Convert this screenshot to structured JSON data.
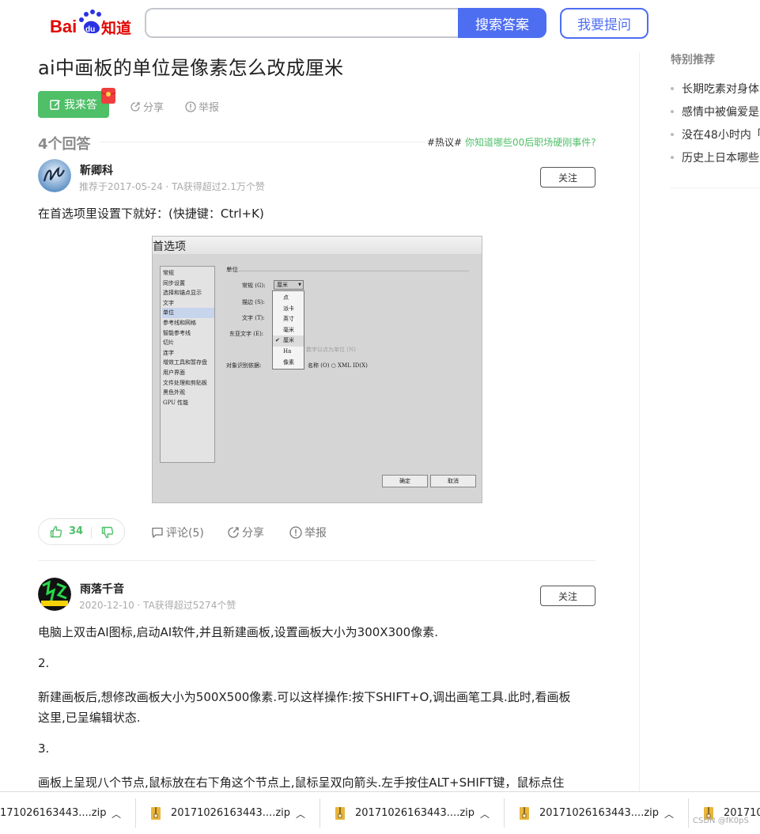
{
  "header": {
    "logo_text": "Bai du 知道",
    "search_placeholder": "",
    "search_button": "搜索答案",
    "ask_button": "我要提问"
  },
  "question": {
    "title": "ai中画板的单位是像素怎么改成厘米",
    "answer_button": "我来答",
    "share": "分享",
    "report": "举报"
  },
  "answers_header": {
    "count_label": "4个回答",
    "hot_tag": "#热议#",
    "hot_text": "你知道哪些00后职场硬刚事件?"
  },
  "answers": [
    {
      "author": "靳卿科",
      "meta": "推荐于2017-05-24 · TA获得超过2.1万个赞",
      "follow": "关注",
      "text": "在首选项里设置下就好：(快捷键：Ctrl+K)",
      "likes": "34",
      "comments": "评论(5)",
      "share": "分享",
      "report": "举报"
    },
    {
      "author": "雨落千音",
      "meta": "2020-12-10 · TA获得超过5274个赞",
      "follow": "关注",
      "paragraphs": [
        "电脑上双击AI图标,启动AI软件,并且新建画板,设置画板大小为300X300像素.",
        "2.",
        "新建画板后,想修改画板大小为500X500像素.可以这样操作:按下SHIFT+O,调出画笔工具.此时,看画板",
        "这里,已呈编辑状态.",
        "3.",
        "画板上呈现八个节点,鼠标放在右下角这个节点上,鼠标呈双向箭头.左手按住ALT+SHIFT键，鼠标点住"
      ]
    }
  ],
  "pref_dialog": {
    "title": "首选项",
    "list": [
      "常规",
      "同步设置",
      "选择和锚点显示",
      "文字",
      "单位",
      "参考线和网格",
      "智能参考线",
      "切片",
      "连字",
      "增效工具和暂存盘",
      "用户界面",
      "文件处理和剪贴板",
      "黑色外观",
      "GPU 性能"
    ],
    "section": "单位",
    "labels": [
      "常规 (G):",
      "描边 (S):",
      "文字 (T):",
      "东亚文字 (E):",
      "对象识别依据:"
    ],
    "combo_value": "厘米",
    "options": [
      "点",
      "派卡",
      "英寸",
      "毫米",
      "厘米",
      "Ha",
      "像素"
    ],
    "faint_text": "数字以点为单位 (N)",
    "radio_text": "名称 (O)  ○ XML ID(X)",
    "ok": "确定",
    "cancel": "取消"
  },
  "sidebar": {
    "title": "特别推荐",
    "items": [
      "长期吃素对身体",
      "感情中被偏爱是",
      "没在48小时内「",
      "历史上日本哪些"
    ]
  },
  "downloads": {
    "items": [
      "171026163443....zip",
      "20171026163443....zip",
      "20171026163443....zip",
      "20171026163443....zip",
      "2017102"
    ]
  },
  "watermark": "CSDN @fK0pS",
  "colors": {
    "brand_blue": "#4e6ef2",
    "brand_green": "#4fbf68"
  }
}
